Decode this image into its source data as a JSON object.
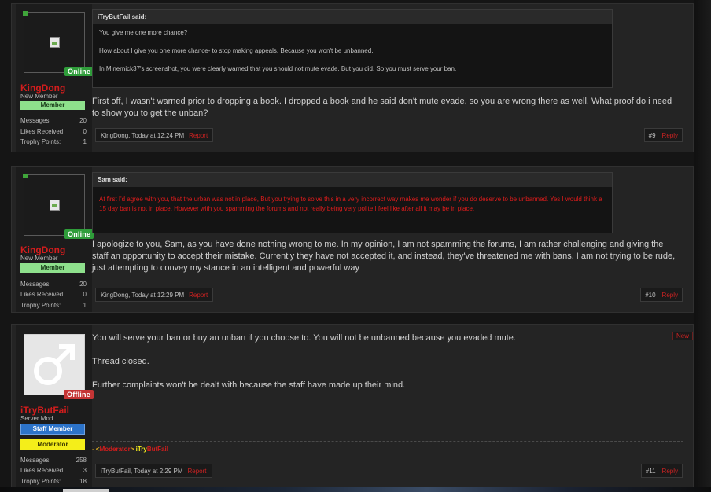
{
  "colors": {
    "background": "#151515",
    "post_bg": "#242424",
    "username": "#d41d1d",
    "report": "#cc2222",
    "online": "#2f9d3a",
    "offline": "#c43535",
    "member_badge": "#8ee08c",
    "staff_badge": "#2c73c9",
    "moderator_badge": "#f4ee1a"
  },
  "stat_labels": {
    "messages": "Messages:",
    "likes": "Likes Received:",
    "trophy": "Trophy Points:"
  },
  "posts": [
    {
      "user": {
        "name": "KingDong",
        "title": "New Member",
        "status": "Online",
        "badge": "Member",
        "messages": "20",
        "likes": "0",
        "trophy": "1",
        "avatar_icon": "broken-image-icon"
      },
      "quote": {
        "header": "iTryButFail said:",
        "lines": [
          "You give me one more chance?",
          "How about I give you one more chance- to stop making appeals. Because you won't be unbanned.",
          "In Minernick37's screenshot, you were clearly warned that you should not mute evade. But you did. So you must serve your ban."
        ]
      },
      "message": "First off, I wasn't warned prior to dropping a book. I dropped a book and he said don't mute evade, so you are wrong there as well. What proof do i need to show you to get the unban?",
      "meta": "KingDong, Today at 12:24 PM",
      "report": "Report",
      "number": "#9",
      "reply": "Reply"
    },
    {
      "user": {
        "name": "KingDong",
        "title": "New Member",
        "status": "Online",
        "badge": "Member",
        "messages": "20",
        "likes": "0",
        "trophy": "1",
        "avatar_icon": "broken-image-icon"
      },
      "quote": {
        "header": "Sam said:",
        "red_text": "At first I'd agree with you, that the urban was not in place, But you trying to solve this in a very incorrect way makes me wonder if you do deserve to be unbanned. Yes I would think a 15 day ban is not in place. However with you spamming the forums and not really being very polite I feel like after all it may be in place."
      },
      "message": "I apologize to you, Sam, as you have done nothing wrong to me. In my opinion, I am not spamming the forums, I am rather challenging and giving the staff an opportunity to accept their mistake. Currently they have not accepted it, and instead, they've threatened me with bans. I am not trying to be rude, just attempting to convey my stance in an intelligent and powerful way",
      "meta": "KingDong, Today at 12:29 PM",
      "report": "Report",
      "number": "#10",
      "reply": "Reply"
    },
    {
      "user": {
        "name": "iTryButFail",
        "title": "Server Mod",
        "status": "Offline",
        "badge": "Staff Member",
        "badge2": "Moderator",
        "messages": "258",
        "likes": "3",
        "trophy": "18",
        "avatar_icon": "male-symbol-icon"
      },
      "paragraphs": [
        "You will serve your ban or buy an unban if you choose to. You will not be unbanned because you evaded mute.",
        "Thread closed.",
        "Further complaints won't be dealt with because the staff have made up their mind."
      ],
      "new_tag": "New",
      "signature": {
        "prefix": "- <",
        "mod": "Moderator",
        "suffix": ">",
        "name_a": "iTry",
        "name_b": "ButFail"
      },
      "meta": "iTryButFail, Today at 2:29 PM",
      "report": "Report",
      "number": "#11",
      "reply": "Reply"
    }
  ]
}
